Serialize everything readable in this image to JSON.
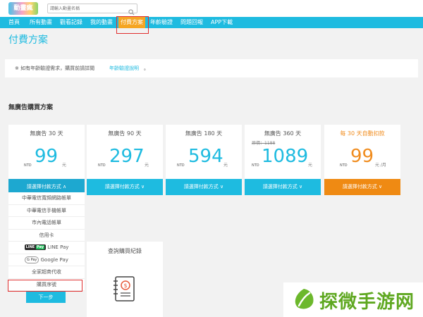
{
  "header": {
    "logo_text": "動畫瘋",
    "search": {
      "placeholder": "請輸入動畫名稱",
      "value": ""
    }
  },
  "nav": {
    "items": [
      {
        "label": "首頁"
      },
      {
        "label": "所有動畫"
      },
      {
        "label": "觀看記錄"
      },
      {
        "label": "我的動畫"
      },
      {
        "label": "付費方案",
        "active": true
      },
      {
        "label": "年齡驗證"
      },
      {
        "label": "問題回報"
      },
      {
        "label": "APP下載"
      }
    ]
  },
  "page": {
    "title": "付費方案",
    "notice_text": "※ 如有年齡驗證需求，購買前請詳閱",
    "notice_link": "年齡驗證說明",
    "notice_suffix": "。",
    "section_title": "無廣告購買方案"
  },
  "plans": [
    {
      "name": "無廣告 30 天",
      "currency": "NTD",
      "price": "99",
      "unit": "元",
      "button": "請選擇付款方式 ∧",
      "expanded": true
    },
    {
      "name": "無廣告 90 天",
      "currency": "NTD",
      "price": "297",
      "unit": "元",
      "button": "請選擇付款方式 ∨"
    },
    {
      "name": "無廣告 180 天",
      "currency": "NTD",
      "price": "594",
      "unit": "元",
      "button": "請選擇付款方式 ∨"
    },
    {
      "name": "無廣告 360 天",
      "original": "原價：1188",
      "currency": "NTD",
      "price": "1089",
      "unit": "元",
      "button": "請選擇付款方式 ∨"
    },
    {
      "name": "每 30 天自動扣款",
      "currency": "NTD",
      "price": "99",
      "unit": "元 /月",
      "button": "請選擇付款方式 ∨",
      "promo": true
    }
  ],
  "payment_methods": [
    "中華電信寬頻網路帳單",
    "中華電信手機帳單",
    "市內電話帳單",
    "信用卡",
    "LINE Pay",
    "Google Pay",
    "全家超商代收",
    "購買序號"
  ],
  "payment_logos": {
    "line_badge": "LINE",
    "line_pay": "Pay",
    "gpay": "G Pay"
  },
  "next_button": "下一步",
  "query": {
    "title": "查詢購買紀錄",
    "icon": "dollar-notebook-icon"
  },
  "watermark": {
    "text": "探微手游网"
  },
  "colors": {
    "accent": "#1ebbe0",
    "orange": "#ef8a13",
    "highlight": "#e02f2f",
    "active_tab": "#f5a523"
  }
}
